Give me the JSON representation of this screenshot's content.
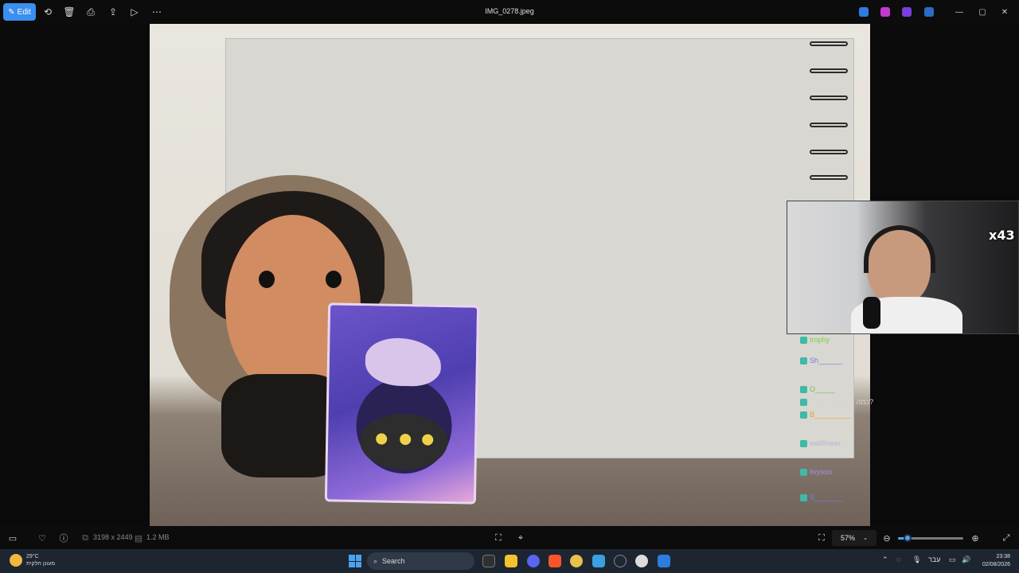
{
  "titlebar": {
    "edit_label": "Edit",
    "filename": "IMG_0278.jpeg"
  },
  "overlay": {
    "multiplier": "x43",
    "chat_lines": [
      {
        "user": "trophy",
        "color": "#7fd14b",
        "message": ""
      },
      {
        "user": "Sh______",
        "color": "#6e7ff0",
        "message": ""
      },
      {
        "user": "O_____",
        "color": "#6fbf57",
        "message": ""
      },
      {
        "user": "",
        "color": "#d6d6d6",
        "message": "כמה בנות שרות שלי?"
      },
      {
        "user": "B_________",
        "color": "#e6a33a",
        "message": ""
      },
      {
        "user": "wallflower",
        "color": "#b6b6d6",
        "message": ""
      },
      {
        "user": "livyixxx",
        "color": "#a58ef0",
        "message": ""
      },
      {
        "user": "S_______",
        "color": "#6e7ff0",
        "message": ""
      }
    ]
  },
  "bottombar": {
    "dimensions": "3198 x 2449",
    "filesize": "1.2 MB",
    "zoom": "57%",
    "zoom_level": 0.15
  },
  "taskbar": {
    "temperature": "29°C",
    "weather_desc": "מעונן חלקית",
    "search_placeholder": "Search",
    "language": "עבר",
    "time": "23:38",
    "date": "02/08/2026"
  },
  "colors": {
    "accent": "#3a8ff0",
    "titlebar_bg": "#0c0c0c",
    "taskbar_bg": "#1d2530"
  }
}
